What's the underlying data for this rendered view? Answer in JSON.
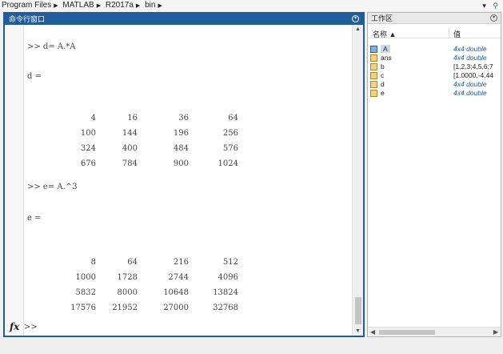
{
  "address": {
    "crumbs": [
      "Program Files",
      "MATLAB",
      "R2017a",
      "bin"
    ]
  },
  "command_window": {
    "title": "命令行窗口",
    "lines": [
      {
        "kind": "cmd",
        "text": ">> d= A.*A"
      },
      {
        "kind": "label",
        "text": "d ="
      },
      {
        "kind": "label",
        "text": ">> e= A.^3"
      },
      {
        "kind": "label",
        "text": "e ="
      }
    ],
    "matrix_d": [
      [
        "4",
        "16",
        "36",
        "64"
      ],
      [
        "100",
        "144",
        "196",
        "256"
      ],
      [
        "324",
        "400",
        "484",
        "576"
      ],
      [
        "676",
        "784",
        "900",
        "1024"
      ]
    ],
    "matrix_e": [
      [
        "8",
        "64",
        "216",
        "512"
      ],
      [
        "1000",
        "1728",
        "2744",
        "4096"
      ],
      [
        "5832",
        "8000",
        "10648",
        "13824"
      ],
      [
        "17576",
        "21952",
        "27000",
        "32768"
      ]
    ],
    "fx": "fx",
    "prompt": ">>"
  },
  "workspace": {
    "title": "工作区",
    "col_name": "名称 ▲",
    "col_value": "值",
    "rows": [
      {
        "name": "A",
        "value": "4x4 double",
        "italic": true,
        "selected": true
      },
      {
        "name": "ans",
        "value": "4x4 double",
        "italic": true,
        "selected": false
      },
      {
        "name": "b",
        "value": "[1,2,3;4,5,6;7",
        "italic": false,
        "selected": false
      },
      {
        "name": "c",
        "value": "[1.0000,-4.44",
        "italic": false,
        "selected": false
      },
      {
        "name": "d",
        "value": "4x4 double",
        "italic": true,
        "selected": false
      },
      {
        "name": "e",
        "value": "4x4 double",
        "italic": true,
        "selected": false
      }
    ]
  }
}
